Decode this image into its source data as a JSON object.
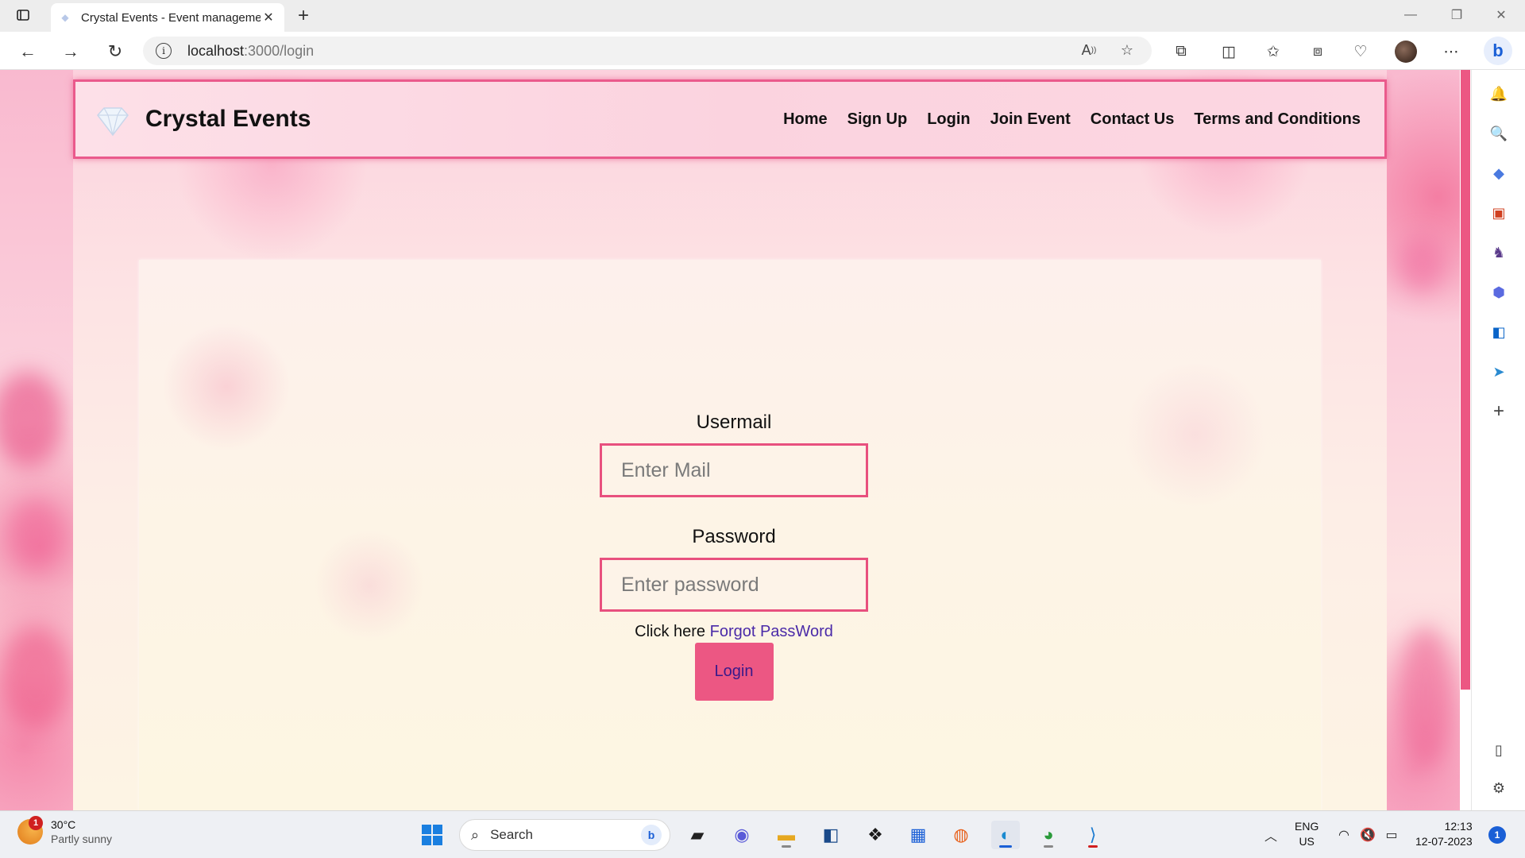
{
  "browser": {
    "tab_title": "Crystal Events - Event manageme",
    "url_host": "localhost",
    "url_path": ":3000/login"
  },
  "site": {
    "brand": "Crystal Events",
    "nav": [
      "Home",
      "Sign Up",
      "Login",
      "Join Event",
      "Contact Us",
      "Terms and Conditions"
    ]
  },
  "login_form": {
    "email_label": "Usermail",
    "email_placeholder": "Enter Mail",
    "password_label": "Password",
    "password_placeholder": "Enter password",
    "forgot_prefix": "Click here ",
    "forgot_link": "Forgot PassWord",
    "submit_label": "Login"
  },
  "taskbar": {
    "weather_temp": "30°C",
    "weather_desc": "Partly sunny",
    "weather_badge": "1",
    "search_label": "Search",
    "lang_top": "ENG",
    "lang_bottom": "US",
    "time": "12:13",
    "date": "12-07-2023",
    "notification_count": "1"
  },
  "colors": {
    "accent_pink": "#ec5783",
    "link_purple": "#4a2aa8",
    "browser_blue": "#1a5fd6"
  }
}
